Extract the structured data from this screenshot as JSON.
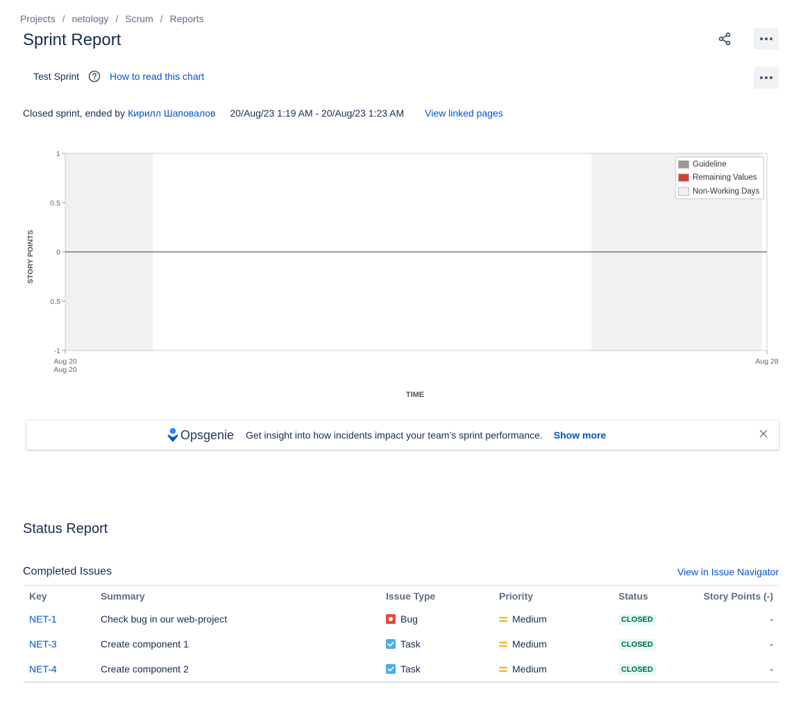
{
  "breadcrumb": [
    "Projects",
    "netology",
    "Scrum",
    "Reports"
  ],
  "page": {
    "title": "Sprint Report",
    "share_icon": "share-icon",
    "more_icon": "more-icon"
  },
  "sprint": {
    "name": "Test Sprint",
    "help_icon": "question-circle-icon",
    "how_to_read": "How to read this chart",
    "closed_prefix": "Closed sprint, ended by",
    "ended_by": "Кирилл Шаповалов",
    "dates": "20/Aug/23 1:19 AM - 20/Aug/23 1:23 AM",
    "linked_pages": "View linked pages"
  },
  "chart_data": {
    "type": "line",
    "xlabel": "TIME",
    "ylabel": "STORY POINTS",
    "y_ticks": [
      "1",
      "0.5",
      "0",
      "0.5",
      "-1"
    ],
    "ylim": [
      -1,
      1
    ],
    "x_ticks": [
      "Aug 20",
      "Aug 28"
    ],
    "x_tick_sub": "Aug 20",
    "xlim": [
      "2023-08-20",
      "2023-08-28"
    ],
    "non_working_days": [
      [
        "2023-08-20",
        "2023-08-21"
      ],
      [
        "2023-08-26",
        "2023-08-28"
      ]
    ],
    "series": [
      {
        "name": "Guideline",
        "color": "#999999",
        "points": [
          [
            "2023-08-20",
            0
          ],
          [
            "2023-08-28",
            0
          ]
        ]
      },
      {
        "name": "Remaining Values",
        "color": "#d04437",
        "points": []
      }
    ],
    "legend": [
      {
        "label": "Guideline",
        "color": "#999999"
      },
      {
        "label": "Remaining Values",
        "color": "#d04437"
      },
      {
        "label": "Non-Working Days",
        "color": "#f0f0f0"
      }
    ],
    "legend_position": "top-right",
    "grid": false
  },
  "banner": {
    "brand": "Opsgenie",
    "text": "Get insight into how incidents impact your team’s sprint performance.",
    "link": "Show more",
    "close_icon": "close-icon"
  },
  "status_report": {
    "title": "Status Report",
    "section": "Completed Issues",
    "navigator_link": "View in Issue Navigator",
    "columns": [
      "Key",
      "Summary",
      "Issue Type",
      "Priority",
      "Status",
      "Story Points (-)"
    ],
    "rows": [
      {
        "key": "NET-1",
        "summary": "Check bug in our web-project",
        "type": "Bug",
        "type_icon": "bug-icon",
        "priority": "Medium",
        "priority_icon": "priority-medium-icon",
        "status": "CLOSED",
        "points": "-"
      },
      {
        "key": "NET-3",
        "summary": "Create component 1",
        "type": "Task",
        "type_icon": "task-icon",
        "priority": "Medium",
        "priority_icon": "priority-medium-icon",
        "status": "CLOSED",
        "points": "-"
      },
      {
        "key": "NET-4",
        "summary": "Create component 2",
        "type": "Task",
        "type_icon": "task-icon",
        "priority": "Medium",
        "priority_icon": "priority-medium-icon",
        "status": "CLOSED",
        "points": "-"
      }
    ]
  },
  "colors": {
    "link": "#0052cc",
    "status_closed_bg": "#e3fcef",
    "status_closed_fg": "#006644",
    "bug": "#e5493a",
    "task": "#4bade8",
    "priority_medium": "#ffab00"
  }
}
